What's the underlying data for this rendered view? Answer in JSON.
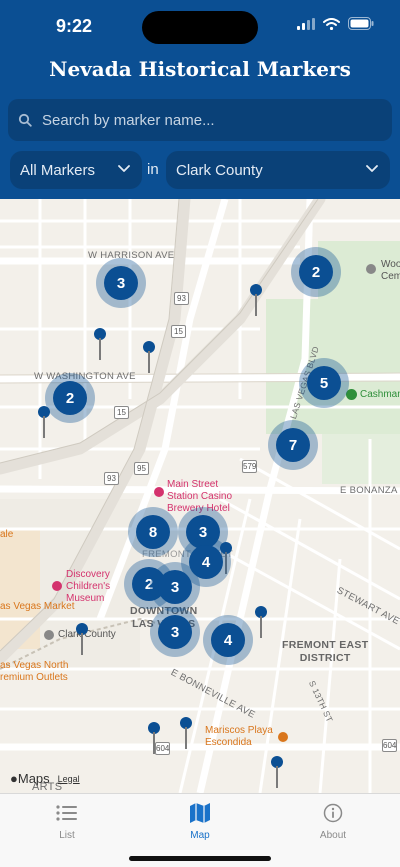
{
  "status_bar": {
    "time": "9:22"
  },
  "app": {
    "title": "Nevada Historical Markers"
  },
  "search": {
    "placeholder": "Search by marker name..."
  },
  "filters": {
    "type_value": "All Markers",
    "connector": "in",
    "county_value": "Clark County"
  },
  "map": {
    "street_labels": [
      "W HARRISON AVE",
      "W WASHINGTON AVE",
      "E BONANZA RD",
      "STEWART AVE",
      "E BONNEVILLE AVE",
      "S 13TH ST",
      "LAS VEGAS BLVD",
      "ARTS",
      "FREMONT STREET"
    ],
    "highway_shields": [
      "93",
      "15",
      "15",
      "95",
      "579",
      "93",
      "604",
      "604"
    ],
    "places": [
      {
        "name": "Main Street Station Casino Brewery Hotel",
        "lines": [
          "Main Street",
          "Station Casino",
          "Brewery Hotel"
        ]
      },
      {
        "name": "Discovery Children's Museum",
        "lines": [
          "Discovery",
          "Children's",
          "Museum"
        ]
      },
      {
        "name": "Las Vegas Market",
        "lines": [
          "as Vegas Market"
        ]
      },
      {
        "name": "Clark County",
        "lines": [
          "Clark County"
        ]
      },
      {
        "name": "Las Vegas North Premium Outlets",
        "lines": [
          "as Vegas North",
          "remium Outlets"
        ]
      },
      {
        "name": "Mariscos Playa Escondida",
        "lines": [
          "Mariscos Playa",
          "Escondida"
        ]
      },
      {
        "name": "Cashman",
        "lines": [
          "Cashman"
        ]
      },
      {
        "name": "Woodlawn Cemetery",
        "lines": [
          "Woo",
          "Cem"
        ]
      },
      {
        "name": "ale",
        "lines": [
          "ale"
        ]
      }
    ],
    "districts": [
      {
        "name": "Downtown Las Vegas",
        "lines": [
          "DOWNTOWN",
          "LAS VEGAS"
        ]
      },
      {
        "name": "Fremont East District",
        "lines": [
          "FREMONT EAST",
          "DISTRICT"
        ]
      }
    ],
    "clusters": [
      "3",
      "2",
      "2",
      "5",
      "7",
      "8",
      "3",
      "4",
      "2",
      "3",
      "3",
      "4"
    ],
    "pin_count": 10,
    "attribution": {
      "brand": "Maps",
      "legal": "Legal"
    }
  },
  "tabs": [
    {
      "label": "List",
      "icon": "list-icon",
      "active": false
    },
    {
      "label": "Map",
      "icon": "map-icon",
      "active": true
    },
    {
      "label": "About",
      "icon": "info-icon",
      "active": false
    }
  ],
  "colors": {
    "header": "#0b4f93",
    "input": "#0a4178",
    "cluster": "#0b4f93",
    "tab_active": "#1a72c9"
  }
}
